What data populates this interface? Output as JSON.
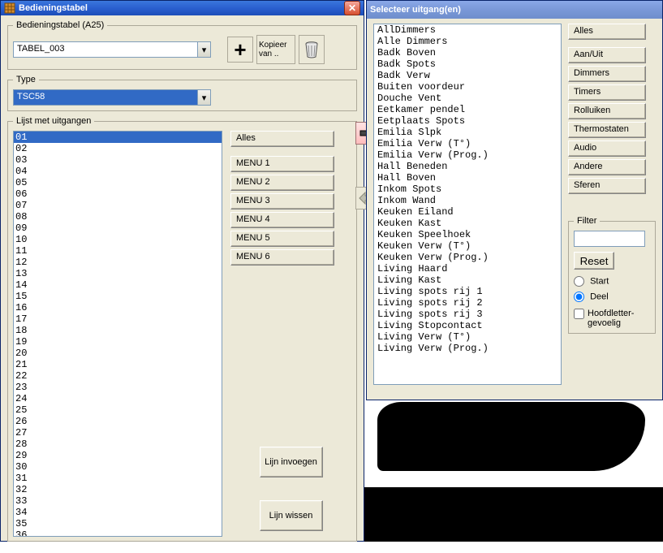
{
  "win_left": {
    "title": "Bedieningstabel",
    "grp_bedieningstabel": "Bedieningstabel (A25)",
    "bedieningstabel_value": "TABEL_003",
    "kopieer_van": "Kopieer van ..",
    "grp_type": "Type",
    "type_value": "TSC58",
    "grp_lijst_uitgangen": "Lijst met uitgangen",
    "rows_count": 36,
    "alles": "Alles",
    "menus": [
      "MENU 1",
      "MENU 2",
      "MENU 3",
      "MENU 4",
      "MENU 5",
      "MENU 6"
    ],
    "lijn_invoegen": "Lijn invoegen",
    "lijn_wissen": "Lijn wissen"
  },
  "win_right": {
    "title": "Selecteer uitgang(en)",
    "uitgangen": [
      "AllDimmers",
      "Alle Dimmers",
      "Badk Boven",
      "Badk Spots",
      "Badk Verw",
      "Buiten voordeur",
      "Douche Vent",
      "Eetkamer pendel",
      "Eetplaats Spots",
      "Emilia Slpk",
      "Emilia Verw (T°)",
      "Emilia Verw (Prog.)",
      "Hall Beneden",
      "Hall Boven",
      "Inkom Spots",
      "Inkom Wand",
      "Keuken Eiland",
      "Keuken Kast",
      "Keuken Speelhoek",
      "Keuken Verw (T°)",
      "Keuken Verw (Prog.)",
      "Living Haard",
      "Living Kast",
      "Living spots rij 1",
      "Living spots rij 2",
      "Living spots rij 3",
      "Living Stopcontact",
      "Living Verw (T°)",
      "Living Verw (Prog.)"
    ],
    "alles": "Alles",
    "categories": [
      "Aan/Uit",
      "Dimmers",
      "Timers",
      "Rolluiken",
      "Thermostaten",
      "Audio",
      "Andere",
      "Sferen"
    ],
    "filter": "Filter",
    "filter_value": "",
    "reset": "Reset",
    "opt_start": "Start",
    "opt_deel": "Deel",
    "opt_deel_checked": true,
    "chk_hoofd": "Hoofdletter-gevoelig",
    "chk_hoofd_checked": false
  }
}
